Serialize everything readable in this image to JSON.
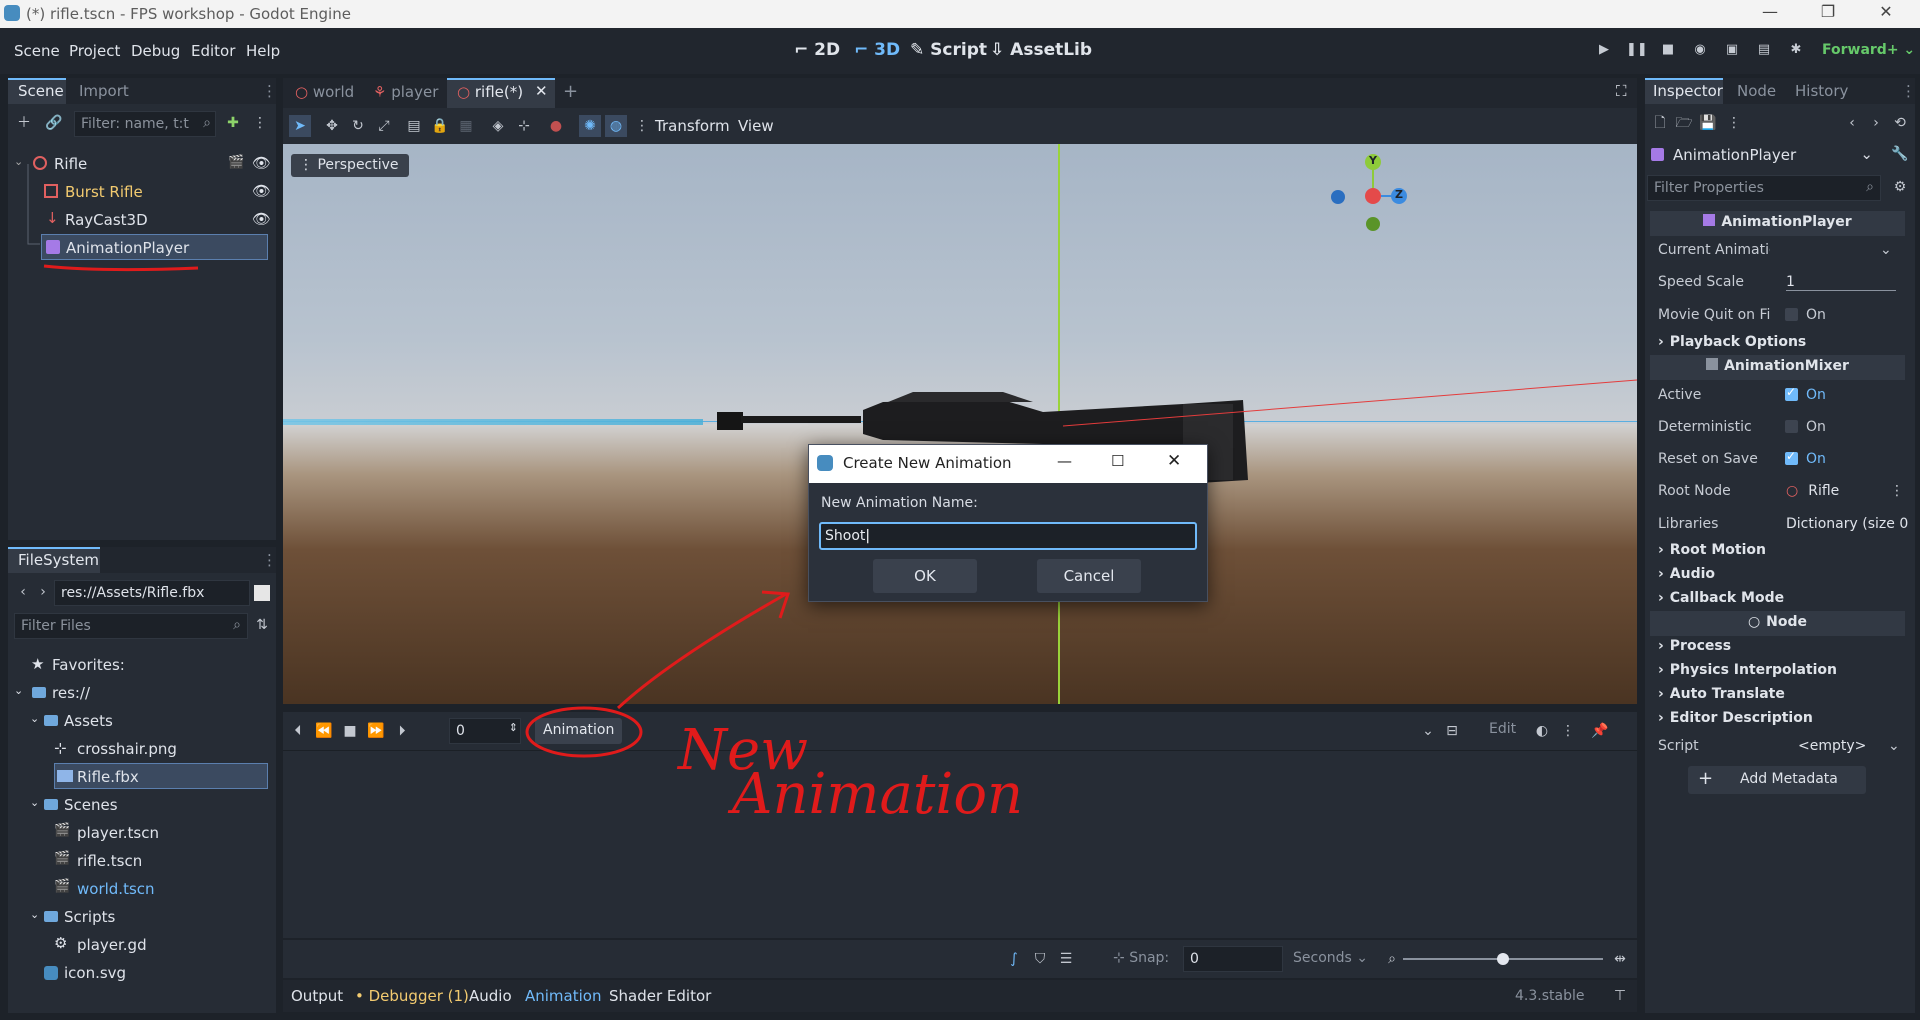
{
  "window": {
    "title": "(*) rifle.tscn - FPS workshop - Godot Engine"
  },
  "menu": [
    "Scene",
    "Project",
    "Debug",
    "Editor",
    "Help"
  ],
  "modes": [
    {
      "label": "2D",
      "icon": "2d-icon"
    },
    {
      "label": "3D",
      "icon": "3d-icon"
    },
    {
      "label": "Script",
      "icon": "script-icon"
    },
    {
      "label": "AssetLib",
      "icon": "assetlib-icon"
    }
  ],
  "renderer": "Forward+",
  "scene_dock": {
    "tabs": [
      "Scene",
      "Import"
    ],
    "filter_placeholder": "Filter: name, t:t",
    "tree": [
      {
        "label": "Rifle",
        "icon": "node3d-icon"
      },
      {
        "label": "Burst Rifle",
        "icon": "mesh-icon"
      },
      {
        "label": "RayCast3D",
        "icon": "raycast-icon"
      },
      {
        "label": "AnimationPlayer",
        "icon": "animation-player-icon"
      }
    ]
  },
  "filesystem": {
    "tab": "FileSystem",
    "path": "res://Assets/Rifle.fbx",
    "filter_placeholder": "Filter Files",
    "items": [
      {
        "label": "Favorites:"
      },
      {
        "label": "res://"
      },
      {
        "label": "Assets"
      },
      {
        "label": "crosshair.png"
      },
      {
        "label": "Rifle.fbx"
      },
      {
        "label": "Scenes"
      },
      {
        "label": "player.tscn"
      },
      {
        "label": "rifle.tscn"
      },
      {
        "label": "world.tscn"
      },
      {
        "label": "Scripts"
      },
      {
        "label": "player.gd"
      },
      {
        "label": "icon.svg"
      }
    ]
  },
  "editor_tabs": [
    "world",
    "player",
    "rifle(*)"
  ],
  "toolbar": {
    "transform": "Transform",
    "view": "View"
  },
  "viewport": {
    "perspective": "Perspective",
    "gizmo": {
      "y": "Y",
      "z": "Z"
    }
  },
  "dialog": {
    "title": "Create New Animation",
    "label": "New Animation Name:",
    "value": "Shoot",
    "ok": "OK",
    "cancel": "Cancel"
  },
  "animation_panel": {
    "time": "0",
    "animation_button": "Animation",
    "edit": "Edit",
    "snap_label": "Snap:",
    "snap_value": "0",
    "unit": "Seconds"
  },
  "bottom_tabs": [
    "Output",
    "Debugger (1)",
    "Audio",
    "Animation",
    "Shader Editor"
  ],
  "version": "4.3.stable",
  "annotation": {
    "line1": "New",
    "line2": "Animation"
  },
  "inspector": {
    "tabs": [
      "Inspector",
      "Node",
      "History"
    ],
    "object": "AnimationPlayer",
    "filter_placeholder": "Filter Properties",
    "header1": "AnimationPlayer",
    "current_animation": "Current Animatio",
    "speed_scale": {
      "key": "Speed Scale",
      "value": "1"
    },
    "movie_quit": {
      "key": "Movie Quit on Fi",
      "value": "On"
    },
    "playback_options": "Playback Options",
    "header2": "AnimationMixer",
    "active": {
      "key": "Active",
      "value": "On"
    },
    "deterministic": {
      "key": "Deterministic",
      "value": "On"
    },
    "reset_on_save": {
      "key": "Reset on Save",
      "value": "On"
    },
    "root_node": {
      "key": "Root Node",
      "value": "Rifle"
    },
    "libraries": {
      "key": "Libraries",
      "value": "Dictionary (size 0"
    },
    "sections": [
      "Root Motion",
      "Audio",
      "Callback Mode"
    ],
    "header3": "Node",
    "node_sections": [
      "Process",
      "Physics Interpolation",
      "Auto Translate",
      "Editor Description"
    ],
    "script": {
      "key": "Script",
      "value": "<empty>"
    },
    "add_metadata": "Add Metadata"
  },
  "colors": {
    "accent": "#70bafa",
    "annotation": "#e01b1b",
    "selection": "#3b4a60"
  }
}
